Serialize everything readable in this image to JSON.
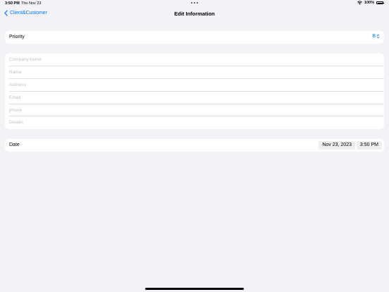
{
  "status_bar": {
    "time": "3:50 PM",
    "date": "Thu Nov 23",
    "battery": "100%"
  },
  "nav": {
    "back_label": "Client&Customer",
    "title": "Edit Information"
  },
  "priority": {
    "label": "Priority",
    "value": "B"
  },
  "fields": [
    {
      "placeholder": "Company name",
      "value": ""
    },
    {
      "placeholder": "Name",
      "value": ""
    },
    {
      "placeholder": "Address",
      "value": ""
    },
    {
      "placeholder": "Email",
      "value": ""
    },
    {
      "placeholder": "phone",
      "value": ""
    },
    {
      "placeholder": "Details",
      "value": ""
    }
  ],
  "date": {
    "label": "Date",
    "date_value": "Nov 23, 2023",
    "time_value": "3:50 PM"
  },
  "colors": {
    "accent": "#007aff",
    "background": "#f2f2f7",
    "card": "#ffffff"
  }
}
